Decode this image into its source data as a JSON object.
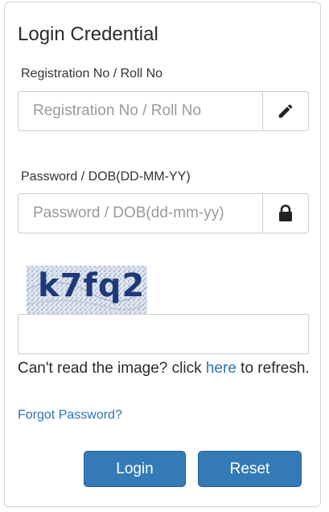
{
  "login": {
    "title": "Login Credential",
    "registration": {
      "label": "Registration No / Roll No",
      "placeholder": "Registration No / Roll No",
      "icon": "pencil-icon"
    },
    "password": {
      "label": "Password / DOB(DD-MM-YY)",
      "placeholder": "Password / DOB(dd-mm-yy)",
      "icon": "lock-icon"
    },
    "captcha": {
      "image_text": "k7fq2",
      "input_value": ""
    },
    "refresh": {
      "prefix": "Can't read the image? click ",
      "link": "here",
      "suffix": " to refresh."
    },
    "forgot_password": "Forgot Password?",
    "buttons": {
      "login": "Login",
      "reset": "Reset"
    },
    "colors": {
      "primary": "#337ab7",
      "link": "#2e73b8",
      "captcha_text": "#1e3a7a"
    }
  }
}
